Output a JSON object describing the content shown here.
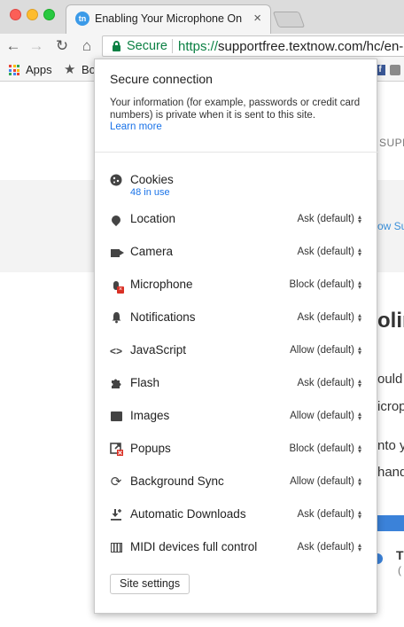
{
  "browser": {
    "tab_title": "Enabling Your Microphone On",
    "tab_favicon_text": "tn",
    "tab_close": "×",
    "nav": {
      "back": "←",
      "forward": "→",
      "reload": "↻",
      "home": "⌂"
    },
    "omnibox": {
      "secure_label": "Secure",
      "url_scheme": "https://",
      "url_host": "supportfree.textnow.com/hc/en-"
    },
    "bookmarks": {
      "apps_label": "Apps",
      "bookmark_partial": "Bo",
      "facebook_glyph": "f",
      "apps_colors": [
        "#ea4335",
        "#fbbc05",
        "#34a853",
        "#4285f4",
        "#ea4335",
        "#fbbc05",
        "#34a853",
        "#4285f4",
        "#ea4335"
      ]
    }
  },
  "page_behind": {
    "header_partial": "SUPP",
    "link_partial": "ow Su",
    "heading_partial": "olin",
    "text_lines": [
      "ould",
      "icrop",
      "nto yo",
      "hand"
    ],
    "card_title_partial": "T",
    "card_sub_partial": "("
  },
  "popup": {
    "title": "Secure connection",
    "description": "Your information (for example, passwords or credit card numbers) is private when it is sent to this site.",
    "learn_more": "Learn more",
    "site_settings_button": "Site settings",
    "permissions": [
      {
        "id": "cookies",
        "label": "Cookies",
        "sub": "48 in use",
        "value": null,
        "icon": "cookie-icon"
      },
      {
        "id": "location",
        "label": "Location",
        "value": "Ask (default)",
        "icon": "location-pin-icon"
      },
      {
        "id": "camera",
        "label": "Camera",
        "value": "Ask (default)",
        "icon": "camera-icon"
      },
      {
        "id": "microphone",
        "label": "Microphone",
        "value": "Block (default)",
        "icon": "microphone-blocked-icon"
      },
      {
        "id": "notifications",
        "label": "Notifications",
        "value": "Ask (default)",
        "icon": "bell-icon"
      },
      {
        "id": "javascript",
        "label": "JavaScript",
        "value": "Allow (default)",
        "icon": "code-brackets-icon"
      },
      {
        "id": "flash",
        "label": "Flash",
        "value": "Ask (default)",
        "icon": "puzzle-icon"
      },
      {
        "id": "images",
        "label": "Images",
        "value": "Allow (default)",
        "icon": "image-icon"
      },
      {
        "id": "popups",
        "label": "Popups",
        "value": "Block (default)",
        "icon": "popup-blocked-icon"
      },
      {
        "id": "background_sync",
        "label": "Background Sync",
        "value": "Allow (default)",
        "icon": "sync-icon"
      },
      {
        "id": "automatic_downloads",
        "label": "Automatic Downloads",
        "value": "Ask (default)",
        "icon": "download-icon"
      },
      {
        "id": "midi",
        "label": "MIDI devices full control",
        "value": "Ask (default)",
        "icon": "piano-keys-icon"
      }
    ]
  },
  "colors": {
    "secure_green": "#0b8043",
    "link_blue": "#1a73e8",
    "block_red": "#d93025"
  }
}
